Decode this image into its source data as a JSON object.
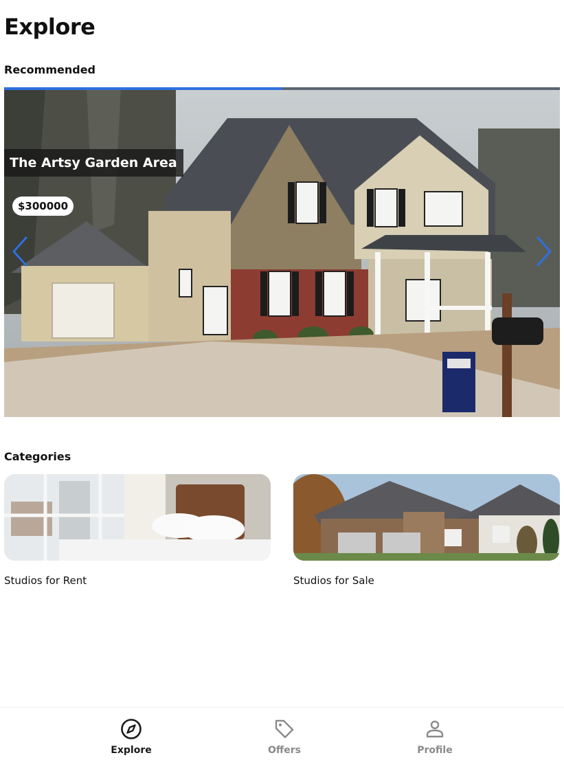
{
  "header": {
    "title": "Explore"
  },
  "recommended": {
    "section_title": "Recommended",
    "progress": 0.5,
    "slide": {
      "title": "The Artsy Garden Area",
      "price": "$300000"
    },
    "prev_icon": "chevron-left-icon",
    "next_icon": "chevron-right-icon"
  },
  "categories": {
    "section_title": "Categories",
    "items": [
      {
        "label": "Studios for Rent"
      },
      {
        "label": "Studios for Sale"
      }
    ]
  },
  "bottom_nav": {
    "items": [
      {
        "label": "Explore",
        "icon": "compass-icon",
        "active": true
      },
      {
        "label": "Offers",
        "icon": "tag-icon",
        "active": false
      },
      {
        "label": "Profile",
        "icon": "person-icon",
        "active": false
      }
    ]
  },
  "colors": {
    "accent": "#2f6fe0",
    "active": "#1a1a1a",
    "inactive": "#8a8a8a"
  }
}
